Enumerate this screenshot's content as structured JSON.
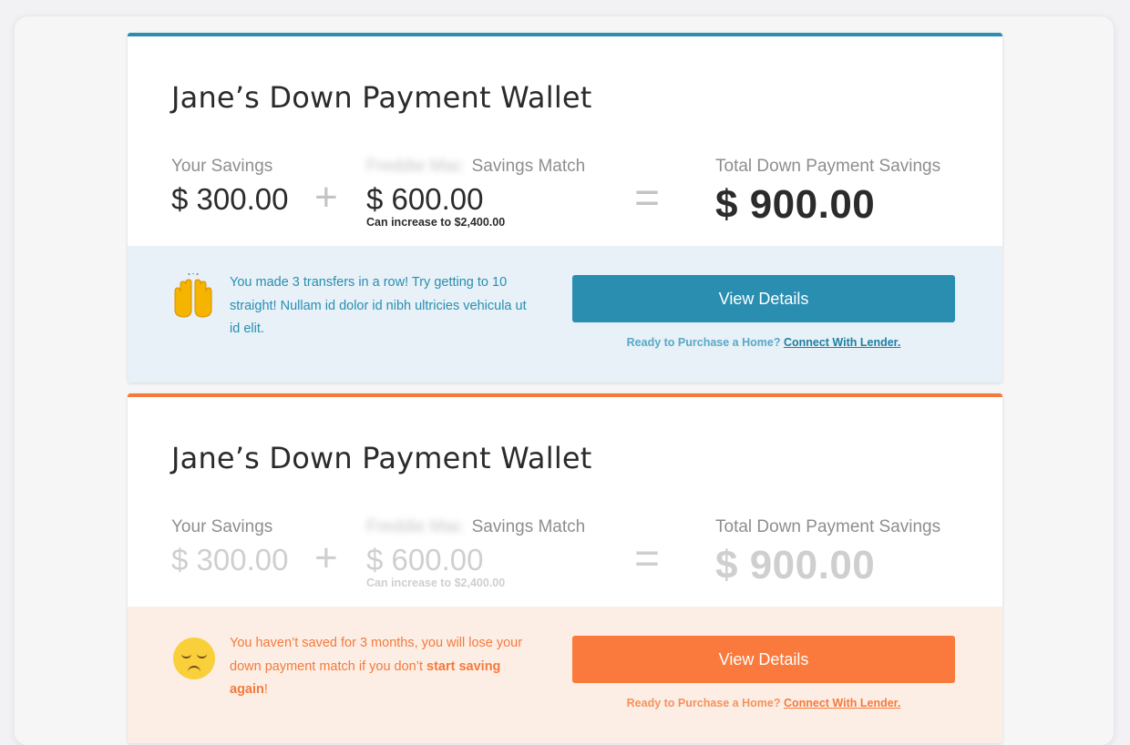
{
  "cards": [
    {
      "title": "Jane’s Down Payment Wallet",
      "your_savings_label": "Your Savings",
      "your_savings_amount": "$ 300.00",
      "plus_symbol": "+",
      "match_sponsor_blurred": "Freddie Mac",
      "match_label": "Savings Match",
      "match_amount": "$ 600.00",
      "match_note": "Can increase to $2,400.00",
      "equals_symbol": "=",
      "total_label": "Total Down Payment Savings",
      "total_amount": "$ 900.00",
      "emoji": "raising-hands-icon",
      "message_text": "You made 3 transfers in a row!  Try getting to 10 straight! Nullam id dolor id nibh ultricies vehicula ut id elit.",
      "button_label": "View Details",
      "ready_prefix": "Ready to Purchase a Home?",
      "ready_link": "Connect With Lender.",
      "accent_color": "#2a8eb1"
    },
    {
      "title": "Jane’s Down Payment Wallet",
      "your_savings_label": "Your Savings",
      "your_savings_amount": "$ 300.00",
      "plus_symbol": "+",
      "match_sponsor_blurred": "Freddie Mac",
      "match_label": "Savings Match",
      "match_amount": "$ 600.00",
      "match_note": "Can increase to $2,400.00",
      "equals_symbol": "=",
      "total_label": "Total Down Payment Savings",
      "total_amount": "$ 900.00",
      "emoji": "pensive-face-icon",
      "message_pre": "You haven’t saved for 3 months, you will lose your down payment match if you don’t",
      "message_bold": "start saving again",
      "message_post": "!",
      "button_label": "View Details",
      "ready_prefix": "Ready to Purchase a Home?",
      "ready_link": "Connect With Lender.",
      "accent_color": "#f47a3c"
    }
  ]
}
